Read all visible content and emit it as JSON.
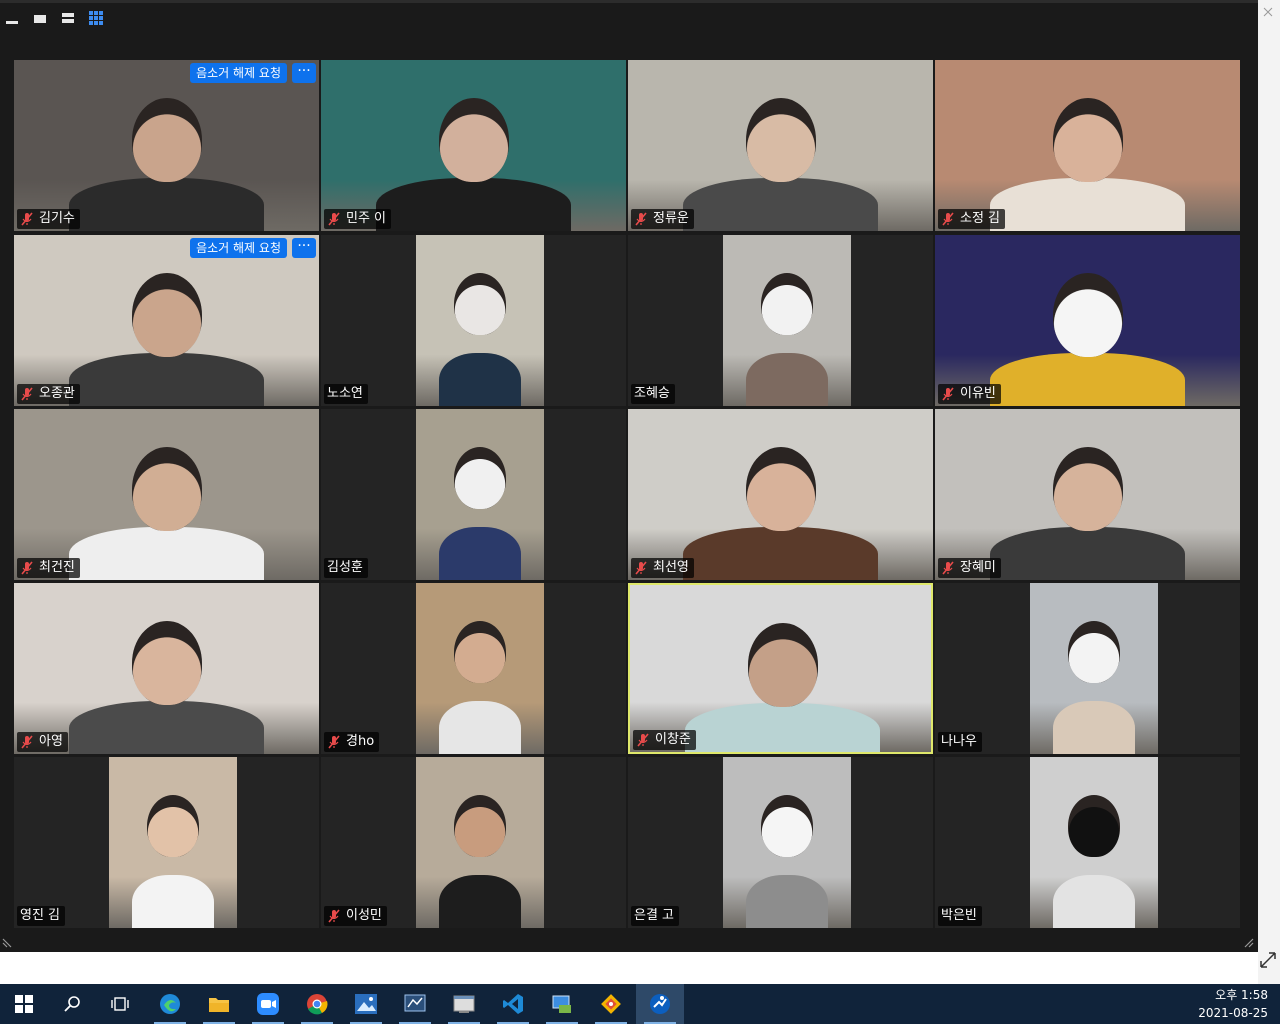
{
  "toolbar": {
    "buttons": [
      {
        "name": "minimize-view-icon"
      },
      {
        "name": "speaker-view-icon"
      },
      {
        "name": "side-by-side-view-icon"
      },
      {
        "name": "gallery-view-icon"
      }
    ]
  },
  "request_unmute_label": "음소거 해제 요청",
  "more_label": "···",
  "participants": [
    {
      "name": "김기수",
      "muted": true,
      "request_unmute": true,
      "bg": "#5a5552",
      "skin": "#c9a48c",
      "shirt": "#2b2b2b",
      "narrow": false
    },
    {
      "name": "민주 이",
      "muted": true,
      "request_unmute": false,
      "bg": "#2f6f6b",
      "skin": "#d2b09c",
      "shirt": "#1d1d1d",
      "narrow": false
    },
    {
      "name": "정류운",
      "muted": true,
      "request_unmute": false,
      "bg": "#b9b6ad",
      "skin": "#d8bba5",
      "shirt": "#4a4a4a",
      "narrow": false
    },
    {
      "name": "소정 김",
      "muted": true,
      "request_unmute": false,
      "bg": "#b88a72",
      "skin": "#d9b29a",
      "shirt": "#e8e0d6",
      "narrow": false
    },
    {
      "name": "오종관",
      "muted": true,
      "request_unmute": true,
      "bg": "#cfc9c0",
      "skin": "#caa58c",
      "shirt": "#3a3a3a",
      "narrow": false
    },
    {
      "name": "노소연",
      "muted": false,
      "request_unmute": false,
      "bg": "#c6c2b6",
      "skin": "#e9e6e4",
      "shirt": "#1f3247",
      "narrow": true
    },
    {
      "name": "조혜승",
      "muted": false,
      "request_unmute": false,
      "bg": "#bcbab5",
      "skin": "#f2f2f2",
      "shirt": "#7d6a60",
      "narrow": true
    },
    {
      "name": "이유빈",
      "muted": true,
      "request_unmute": false,
      "bg": "#2a2860",
      "skin": "#f5f5f5",
      "shirt": "#e0b02a",
      "narrow": false
    },
    {
      "name": "최건진",
      "muted": true,
      "request_unmute": false,
      "bg": "#9c968c",
      "skin": "#d1ae94",
      "shirt": "#eeeeee",
      "narrow": false
    },
    {
      "name": "김성훈",
      "muted": false,
      "request_unmute": false,
      "bg": "#a7a090",
      "skin": "#f0f0f0",
      "shirt": "#2b3a6a",
      "narrow": true
    },
    {
      "name": "최선영",
      "muted": true,
      "request_unmute": false,
      "bg": "#cfcdc8",
      "skin": "#d8b29a",
      "shirt": "#5a3a2a",
      "narrow": false
    },
    {
      "name": "장혜미",
      "muted": true,
      "request_unmute": false,
      "bg": "#c2c0bc",
      "skin": "#d6b39b",
      "shirt": "#3a3a3a",
      "narrow": false
    },
    {
      "name": "아영",
      "muted": true,
      "request_unmute": false,
      "bg": "#d8d2cc",
      "skin": "#d9b59d",
      "shirt": "#4b4b4b",
      "narrow": false
    },
    {
      "name": "경ho",
      "muted": true,
      "request_unmute": false,
      "bg": "#b69a78",
      "skin": "#d3ac90",
      "shirt": "#e6e6e6",
      "narrow": true
    },
    {
      "name": "이창준",
      "muted": true,
      "request_unmute": false,
      "bg": "#d9d9d9",
      "skin": "#c4a088",
      "shirt": "#b9d3d3",
      "narrow": false,
      "active": true
    },
    {
      "name": "나나우",
      "muted": false,
      "request_unmute": false,
      "bg": "#b8bcc0",
      "skin": "#f3f3f3",
      "shirt": "#d9c9b8",
      "narrow": true
    },
    {
      "name": "영진 김",
      "muted": false,
      "request_unmute": false,
      "bg": "#c9b9a6",
      "skin": "#e2c2a8",
      "shirt": "#f3f3f3",
      "narrow": true
    },
    {
      "name": "이성민",
      "muted": true,
      "request_unmute": false,
      "bg": "#b7ab9a",
      "skin": "#c89c7e",
      "shirt": "#1d1d1d",
      "narrow": true
    },
    {
      "name": "은결 고",
      "muted": false,
      "request_unmute": false,
      "bg": "#bdbdbd",
      "skin": "#f5f5f5",
      "shirt": "#8d8d8d",
      "narrow": true
    },
    {
      "name": "박은빈",
      "muted": false,
      "request_unmute": false,
      "bg": "#cfcfcf",
      "skin": "#111111",
      "shirt": "#e3e3e3",
      "narrow": true
    }
  ],
  "taskbar": {
    "apps": [
      {
        "name": "start-icon"
      },
      {
        "name": "search-icon"
      },
      {
        "name": "task-view-icon"
      },
      {
        "name": "edge-icon"
      },
      {
        "name": "file-explorer-icon"
      },
      {
        "name": "zoom-icon"
      },
      {
        "name": "chrome-icon"
      },
      {
        "name": "photos-icon"
      },
      {
        "name": "network-app-icon"
      },
      {
        "name": "window-app-icon"
      },
      {
        "name": "vscode-icon"
      },
      {
        "name": "remote-desktop-icon"
      },
      {
        "name": "git-icon"
      },
      {
        "name": "active-app-icon"
      }
    ],
    "time": "오후 1:58",
    "date": "2021-08-25"
  }
}
